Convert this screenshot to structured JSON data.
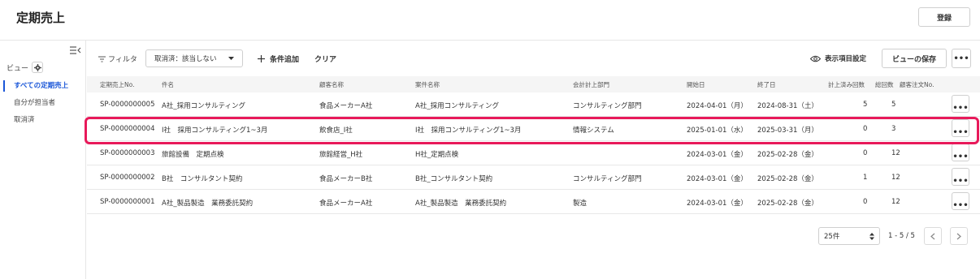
{
  "header": {
    "title": "定期売上",
    "register_label": "登録"
  },
  "sidebar": {
    "view_label": "ビュー",
    "items": [
      {
        "label": "すべての定期売上",
        "active": true
      },
      {
        "label": "自分が担当者",
        "active": false
      },
      {
        "label": "取消済",
        "active": false
      }
    ]
  },
  "toolbar": {
    "filter_label": "フィルタ",
    "filter_value": "取消済：該当しない",
    "add_condition_label": "条件追加",
    "clear_label": "クリア",
    "display_settings_label": "表示項目設定",
    "save_view_label": "ビューの保存"
  },
  "table": {
    "columns": [
      "定期売上No.",
      "件名",
      "顧客名称",
      "案件名称",
      "会計計上部門",
      "開始日",
      "終了日",
      "計上済み回数",
      "総回数",
      "顧客注文No."
    ],
    "rows": [
      {
        "no": "SP-0000000005",
        "subject": "A社_採用コンサルティング",
        "customer": "食品メーカーA社",
        "project": "A社_採用コンサルティング",
        "dept": "コンサルティング部門",
        "start": "2024-04-01（月）",
        "end": "2024-08-31（土）",
        "done": "5",
        "total": "5",
        "order": ""
      },
      {
        "no": "SP-0000000004",
        "subject": "I社　採用コンサルティング1~3月",
        "customer": "飲食店_I社",
        "project": "I社　採用コンサルティング1~3月",
        "dept": "情報システム",
        "start": "2025-01-01（水）",
        "end": "2025-03-31（月）",
        "done": "0",
        "total": "3",
        "order": ""
      },
      {
        "no": "SP-0000000003",
        "subject": "旅館設備　定期点検",
        "customer": "旅館経営_H社",
        "project": "H社_定期点検",
        "dept": "",
        "start": "2024-03-01（金）",
        "end": "2025-02-28（金）",
        "done": "0",
        "total": "12",
        "order": ""
      },
      {
        "no": "SP-0000000002",
        "subject": "B社　コンサルタント契約",
        "customer": "食品メーカーB社",
        "project": "B社_コンサルタント契約",
        "dept": "コンサルティング部門",
        "start": "2024-03-01（金）",
        "end": "2025-02-28（金）",
        "done": "1",
        "total": "12",
        "order": ""
      },
      {
        "no": "SP-0000000001",
        "subject": "A社_製品製造　業務委託契約",
        "customer": "食品メーカーA社",
        "project": "A社_製品製造　業務委託契約",
        "dept": "製造",
        "start": "2024-03-01（金）",
        "end": "2025-02-28（金）",
        "done": "0",
        "total": "12",
        "order": ""
      }
    ]
  },
  "pagination": {
    "per_page": "25件",
    "range": "1 - 5 / 5"
  },
  "colors": {
    "accent": "#1a56d8",
    "highlight": "#e8195a"
  }
}
